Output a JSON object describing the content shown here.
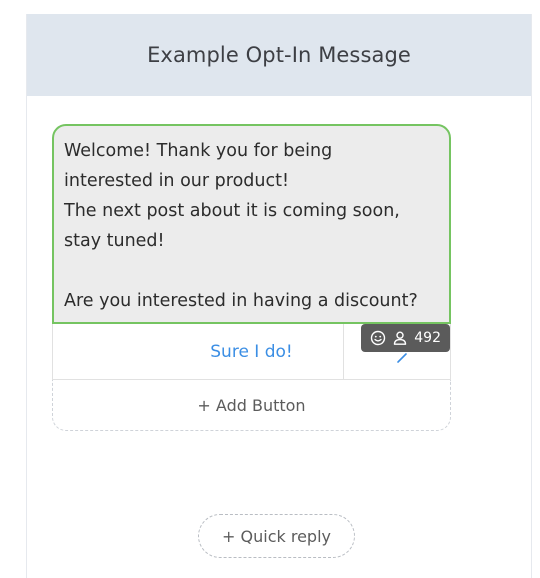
{
  "header": {
    "title": "Example Opt-In Message"
  },
  "message": {
    "lines": [
      "Welcome! Thank you for being",
      "interested in our product!",
      "The next post about it is coming soon,",
      "stay tuned!",
      "",
      "Are you interested in having a discount?"
    ],
    "buttons": [
      {
        "label": "Sure I do!"
      }
    ],
    "stats": {
      "emoji_icon": "smiley-icon",
      "user_icon": "user-icon",
      "count": "492"
    },
    "add_button_label": "+ Add Button"
  },
  "quick_reply": {
    "label": "+ Quick reply"
  },
  "colors": {
    "header_bg": "#dfe6ee",
    "bubble_bg": "#ececec",
    "bubble_border": "#75c461",
    "button_text": "#3b8ee4",
    "badge_bg": "#5b5b5b"
  }
}
